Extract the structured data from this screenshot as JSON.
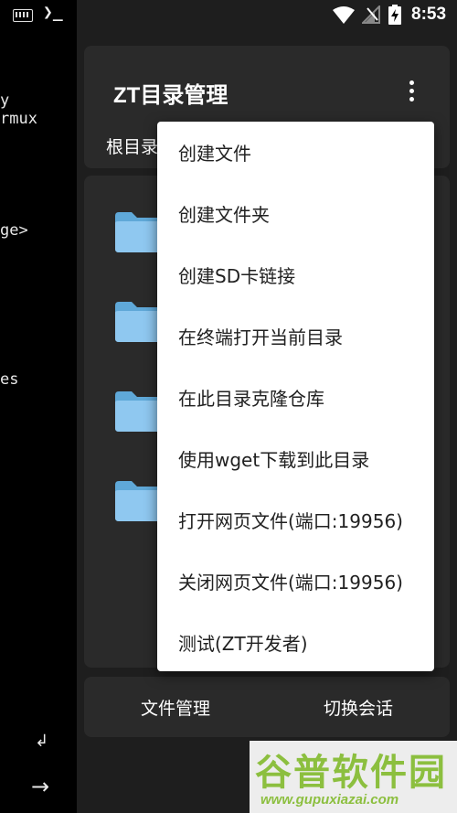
{
  "status_bar": {
    "time": "8:53",
    "icons": [
      "keyboard-icon",
      "terminal-icon",
      "wifi-icon",
      "no-signal-icon",
      "battery-charging-icon"
    ]
  },
  "terminal": {
    "lines": [
      "y",
      "rmux",
      "ge>",
      "es"
    ],
    "enter_glyph": "↲",
    "arrow_glyph": "→",
    "prompt_glyph": "❯_"
  },
  "header": {
    "title": "ZT目录管理",
    "breadcrumb": "根目录",
    "more_icon": "more-vert-icon"
  },
  "file_list": {
    "folder_icon": "folder-icon",
    "folder_color": "#8fc8f0",
    "folder_count": 4
  },
  "menu": {
    "items": [
      "创建文件",
      "创建文件夹",
      "创建SD卡链接",
      "在终端打开当前目录",
      "在此目录克隆仓库",
      "使用wget下载到此目录",
      "打开网页文件(端口:19956)",
      "关闭网页文件(端口:19956)",
      "测试(ZT开发者)"
    ]
  },
  "bottom_nav": {
    "files": "文件管理",
    "switch_session": "切换会话"
  },
  "watermark": {
    "title": "谷普软件园",
    "url": "www.gupuxiazai.com"
  },
  "colors": {
    "background": "#1e1e1e",
    "card": "#2a2a2a",
    "menu_bg": "#ffffff",
    "menu_text": "#212121",
    "watermark": "#8cbf3f"
  }
}
